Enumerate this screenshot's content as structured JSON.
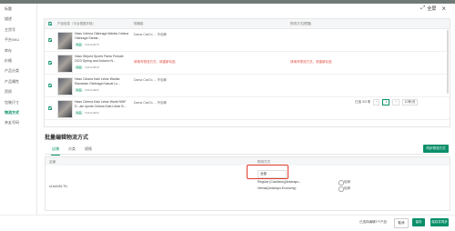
{
  "header": {
    "fullscreen_label": "全屏",
    "close_glyph": "×",
    "expand_glyph": "⤢"
  },
  "sidebar": {
    "items": [
      {
        "label": "标题"
      },
      {
        "label": "描述"
      },
      {
        "label": "主货号"
      },
      {
        "label": "平台SKU"
      },
      {
        "label": "库存"
      },
      {
        "label": "价格"
      },
      {
        "label": "产品分类"
      },
      {
        "label": "产品属性"
      },
      {
        "label": "资质"
      },
      {
        "label": "包装尺寸"
      },
      {
        "label": "物流方式"
      },
      {
        "label": "亲友号码"
      }
    ],
    "active_index": 10
  },
  "table": {
    "col_product": "产品信息（平台视图字段）",
    "col_spec": "规格组",
    "col_logistics": "物流方式(联盟)",
    "rows": [
      {
        "name": "Hass Celena Olahraga Wanita Celana Olahraga Santai...",
        "tag": "商品",
        "sku": "V24sKdd78",
        "spec": "Dama Cla/Cs ... 不包邮",
        "error": "",
        "error2": ""
      },
      {
        "name": "Hass Striped Sports Pants Female 2023 Spring and Autumn N...",
        "tag": "商品",
        "sku": "V24sKd6C8",
        "spec": "",
        "error": "请填写物流方式，请重新勾选",
        "error2": "请填写物流方式，请重新勾选"
      },
      {
        "name": "Hass Celana Kaki Lebar Wanita Ramadan Olahraga Kasual Lo...",
        "tag": "商品",
        "sku": "V24sKdd6C",
        "spec": "Dama Cla/Cs ... 不包邮",
        "error": "",
        "error2": ""
      },
      {
        "name": "Hass Celena Kaki Lebar Wanit NWF D...ain sports Celana Kaki Lebar B...",
        "tag": "商品",
        "sku": "V24sKdd6C",
        "spec": "Dama Cla/Cs ... 不包邮",
        "error": "",
        "error2": ""
      }
    ],
    "pager": {
      "total": "已选 3/3 条",
      "prev": "‹",
      "page": "1",
      "next": "›",
      "page_size": "10条/页"
    }
  },
  "bulk": {
    "title": "批量编辑物流方式",
    "tabs": [
      "店铺",
      "分类",
      "规格"
    ],
    "active_tab": 0,
    "sync_button": "同步物流方式",
    "col_name": "店铺",
    "col_logistics": "物流方式",
    "row_label": "s1lvehiDLTN",
    "select_value": "全部",
    "options": [
      {
        "label": "Regular (Cashless)(Antarapu..."
      },
      {
        "label": "Hemat(Antarapu Economy)"
      }
    ],
    "radio_labels": [
      "包邮",
      "包邮"
    ]
  },
  "footer": {
    "selected_count": "已选择编辑3个产品",
    "cancel": "取消",
    "save": "保存",
    "save_and_sync": "保存并同步"
  },
  "colors": {
    "accent": "#0a8f6a",
    "error": "#e04a3f",
    "highlight": "#e03c2c"
  }
}
